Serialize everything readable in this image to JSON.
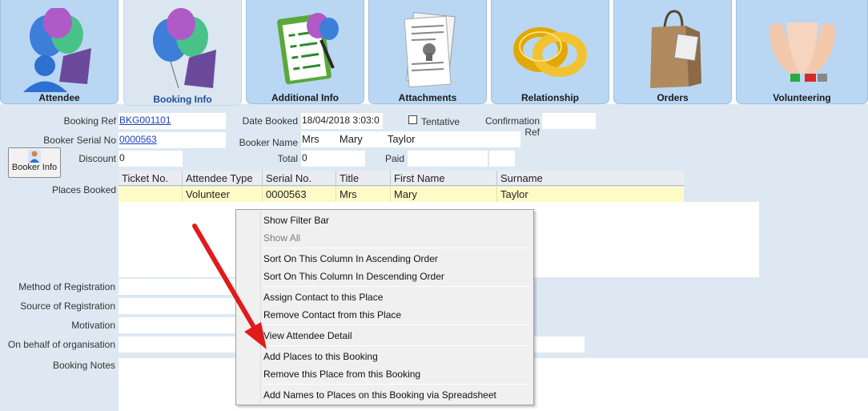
{
  "tabs": [
    {
      "label": "Attendee",
      "icon": "balloons-person-icon"
    },
    {
      "label": "Booking Info",
      "icon": "balloons-icon"
    },
    {
      "label": "Additional Info",
      "icon": "clipboard-icon"
    },
    {
      "label": "Attachments",
      "icon": "pinned-paper-icon"
    },
    {
      "label": "Relationship",
      "icon": "rings-icon"
    },
    {
      "label": "Orders",
      "icon": "shopping-bag-icon"
    },
    {
      "label": "Volunteering",
      "icon": "hands-icon"
    }
  ],
  "active_tab": "Booking Info",
  "form": {
    "booking_ref_label": "Booking Ref",
    "booking_ref": "BKG001101",
    "date_booked_label": "Date Booked",
    "date_booked": "18/04/2018 3:03:0",
    "tentative_label": "Tentative",
    "confirmation_ref_label": "Confirmation Ref",
    "confirmation_ref": "",
    "booker_serial_label": "Booker Serial No",
    "booker_serial": "0000563",
    "booker_name_label": "Booker Name",
    "booker_title": "Mrs",
    "booker_first": "Mary",
    "booker_last": "Taylor",
    "booker_info_button": "Booker Info",
    "discount_label": "Discount",
    "discount": "0",
    "total_label": "Total",
    "total": "0",
    "paid_label": "Paid",
    "paid": "",
    "places_booked_label": "Places Booked",
    "method_label": "Method of Registration",
    "source_label": "Source of Registration",
    "motivation_label": "Motivation",
    "behalf_label": "On behalf of organisation",
    "notes_label": "Booking Notes"
  },
  "grid": {
    "columns": [
      "Ticket No.",
      "Attendee Type",
      "Serial No.",
      "Title",
      "First Name",
      "Surname"
    ],
    "rows": [
      [
        "",
        "Volunteer",
        "0000563",
        "Mrs",
        "Mary",
        "Taylor"
      ]
    ]
  },
  "context_menu": {
    "items": [
      {
        "label": "Show Filter Bar",
        "enabled": true
      },
      {
        "label": "Show All",
        "enabled": false
      },
      {
        "label": "Sort On This Column In Ascending Order",
        "enabled": true
      },
      {
        "label": "Sort On This Column In Descending Order",
        "enabled": true
      },
      {
        "label": "Assign Contact to this Place",
        "enabled": true
      },
      {
        "label": "Remove Contact from this Place",
        "enabled": true
      },
      {
        "label": "View Attendee Detail",
        "enabled": true
      },
      {
        "label": "Add Places to this Booking",
        "enabled": true
      },
      {
        "label": "Remove this Place from this Booking",
        "enabled": true
      },
      {
        "label": "Add Names to Places on this Booking via Spreadsheet",
        "enabled": true
      }
    ]
  },
  "colors": {
    "tab_bg": "#b9d7f3",
    "active_tab_bg": "#dbe6f1",
    "row_highlight": "#fffbc7",
    "annotation_arrow": "#e01b1b"
  }
}
